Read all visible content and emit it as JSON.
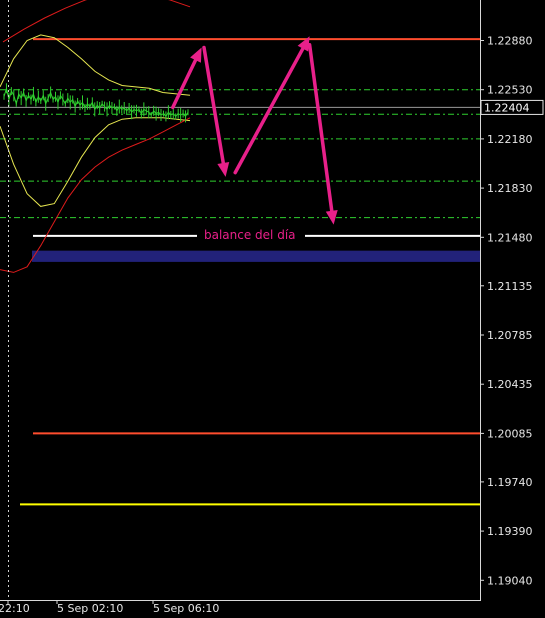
{
  "chart_data": {
    "type": "line",
    "instrument_note": "",
    "y_axis": {
      "ticks": [
        1.2288,
        1.2253,
        1.2218,
        1.2183,
        1.2148,
        1.21135,
        1.20785,
        1.20435,
        1.20085,
        1.1974,
        1.1939,
        1.1904
      ],
      "tick_labels": [
        "1.22880",
        "1.22530",
        "1.22180",
        "1.21830",
        "1.21480",
        "1.21135",
        "1.20785",
        "1.20435",
        "1.20085",
        "1.19740",
        "1.19390",
        "1.19040"
      ],
      "range": [
        1.18885,
        1.23215
      ]
    },
    "x_axis": {
      "tick_labels": [
        "22:10",
        "5 Sep 02:10",
        "5 Sep 06:10"
      ]
    },
    "current_price": {
      "value": 1.22404,
      "label": "1.22404"
    },
    "horizontal_levels": [
      {
        "name": "red-level-top",
        "value": 1.2289,
        "color": "#ff4d2e",
        "style": "solid"
      },
      {
        "name": "green-dash-1",
        "value": 1.2253,
        "color": "#2fcf2f",
        "style": "dashdot"
      },
      {
        "name": "green-dash-2",
        "value": 1.22355,
        "color": "#2fcf2f",
        "style": "dashdot"
      },
      {
        "name": "green-dash-3",
        "value": 1.2218,
        "color": "#2fcf2f",
        "style": "dashdot"
      },
      {
        "name": "green-dash-4",
        "value": 1.2188,
        "color": "#2fcf2f",
        "style": "dashdot"
      },
      {
        "name": "green-dash-5",
        "value": 1.2162,
        "color": "#2fcf2f",
        "style": "dashdot"
      },
      {
        "name": "white-balance",
        "value": 1.2149,
        "color": "#ffffff",
        "style": "solid"
      },
      {
        "name": "red-level-bottom",
        "value": 1.20085,
        "color": "#ff4d2e",
        "style": "solid"
      },
      {
        "name": "yellow-level",
        "value": 1.1958,
        "color": "#ffff00",
        "style": "solid"
      }
    ],
    "zone": {
      "name": "navy-zone",
      "from": 1.21385,
      "to": 1.21305,
      "color": "#22227a"
    },
    "annotation": {
      "text": "balance del día",
      "color": "#e8208a"
    },
    "price_series": {
      "color": "#2fcf2f",
      "values": [
        1.2248,
        1.2254,
        1.2246,
        1.2252,
        1.2249,
        1.2243,
        1.225,
        1.2247,
        1.2251,
        1.2245,
        1.2249,
        1.2246,
        1.225,
        1.2244,
        1.2248,
        1.2245,
        1.2249,
        1.2243,
        1.2247,
        1.2251,
        1.2246,
        1.2248,
        1.2244,
        1.2249,
        1.2246,
        1.2243,
        1.2247,
        1.2244,
        1.2246,
        1.2241,
        1.2245,
        1.2242,
        1.2244,
        1.224,
        1.2243,
        1.2241,
        1.2244,
        1.2239,
        1.2242,
        1.224,
        1.2243,
        1.2241,
        1.2239,
        1.2242,
        1.224,
        1.2241,
        1.2238,
        1.2241,
        1.2239,
        1.224,
        1.2238,
        1.224,
        1.2237,
        1.2239,
        1.2238,
        1.2239,
        1.2236,
        1.2239,
        1.2238,
        1.2237,
        1.2235,
        1.2238,
        1.2236,
        1.2237,
        1.2235,
        1.2236,
        1.2234,
        1.2237,
        1.2235,
        1.2236,
        1.2234,
        1.2236,
        1.2235,
        1.2236,
        1.2234,
        1.2237
      ]
    },
    "bands": [
      {
        "name": "yellow-band-upper",
        "color": "#e6e650",
        "values": [
          1.2255,
          1.2275,
          1.2288,
          1.2292,
          1.229,
          1.2283,
          1.2275,
          1.2266,
          1.226,
          1.2256,
          1.2255,
          1.2254,
          1.2251,
          1.225,
          1.2249
        ]
      },
      {
        "name": "yellow-band-lower",
        "color": "#e6e650",
        "values": [
          1.2227,
          1.22,
          1.2179,
          1.217,
          1.2172,
          1.2188,
          1.2205,
          1.2219,
          1.2228,
          1.2232,
          1.2233,
          1.2233,
          1.2233,
          1.2232,
          1.2231
        ]
      },
      {
        "name": "red-band-upper",
        "color": "#dd1b1b",
        "values": [
          1.2287,
          1.2296,
          1.2304,
          1.2311,
          1.2317,
          1.232,
          1.2321,
          1.232,
          1.2317,
          1.2312
        ]
      },
      {
        "name": "red-band-lower",
        "color": "#dd1b1b",
        "values": [
          1.2125,
          1.2123,
          1.2127,
          1.2142,
          1.2159,
          1.2176,
          1.2189,
          1.2198,
          1.2205,
          1.221,
          1.2214,
          1.2218,
          1.2223,
          1.2228,
          1.2233
        ]
      }
    ],
    "arrows": [
      {
        "name": "arrow-1",
        "from": [
          0.36,
          1.22404
        ],
        "to": [
          0.42,
          1.2283
        ]
      },
      {
        "name": "arrow-2",
        "from": [
          0.425,
          1.2283
        ],
        "to": [
          0.47,
          1.2191
        ]
      },
      {
        "name": "arrow-3",
        "from": [
          0.49,
          1.2194
        ],
        "to": [
          0.645,
          1.2291
        ]
      },
      {
        "name": "arrow-4",
        "from": [
          0.645,
          1.2285
        ],
        "to": [
          0.695,
          1.2157
        ]
      }
    ]
  }
}
